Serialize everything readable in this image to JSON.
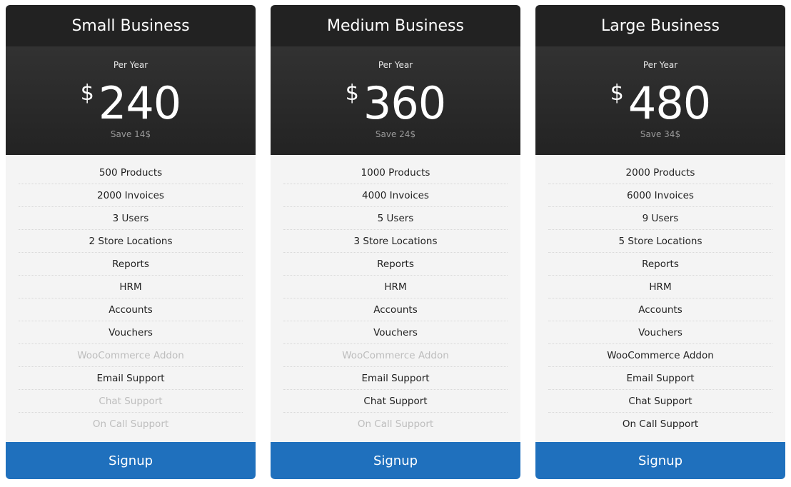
{
  "plans": [
    {
      "name": "Small Business",
      "period": "Per Year",
      "currency": "$",
      "price": "240",
      "savings": "Save 14$",
      "features": [
        {
          "label": "500 Products",
          "included": true
        },
        {
          "label": "2000 Invoices",
          "included": true
        },
        {
          "label": "3 Users",
          "included": true
        },
        {
          "label": "2 Store Locations",
          "included": true
        },
        {
          "label": "Reports",
          "included": true
        },
        {
          "label": "HRM",
          "included": true
        },
        {
          "label": "Accounts",
          "included": true
        },
        {
          "label": "Vouchers",
          "included": true
        },
        {
          "label": "WooCommerce Addon",
          "included": false
        },
        {
          "label": "Email Support",
          "included": true
        },
        {
          "label": "Chat Support",
          "included": false
        },
        {
          "label": "On Call Support",
          "included": false
        }
      ],
      "button_label": "Signup"
    },
    {
      "name": "Medium Business",
      "period": "Per Year",
      "currency": "$",
      "price": "360",
      "savings": "Save 24$",
      "features": [
        {
          "label": "1000 Products",
          "included": true
        },
        {
          "label": "4000 Invoices",
          "included": true
        },
        {
          "label": "5 Users",
          "included": true
        },
        {
          "label": "3 Store Locations",
          "included": true
        },
        {
          "label": "Reports",
          "included": true
        },
        {
          "label": "HRM",
          "included": true
        },
        {
          "label": "Accounts",
          "included": true
        },
        {
          "label": "Vouchers",
          "included": true
        },
        {
          "label": "WooCommerce Addon",
          "included": false
        },
        {
          "label": "Email Support",
          "included": true
        },
        {
          "label": "Chat Support",
          "included": true
        },
        {
          "label": "On Call Support",
          "included": false
        }
      ],
      "button_label": "Signup"
    },
    {
      "name": "Large Business",
      "period": "Per Year",
      "currency": "$",
      "price": "480",
      "savings": "Save 34$",
      "features": [
        {
          "label": "2000 Products",
          "included": true
        },
        {
          "label": "6000 Invoices",
          "included": true
        },
        {
          "label": "9 Users",
          "included": true
        },
        {
          "label": "5 Store Locations",
          "included": true
        },
        {
          "label": "Reports",
          "included": true
        },
        {
          "label": "HRM",
          "included": true
        },
        {
          "label": "Accounts",
          "included": true
        },
        {
          "label": "Vouchers",
          "included": true
        },
        {
          "label": "WooCommerce Addon",
          "included": true
        },
        {
          "label": "Email Support",
          "included": true
        },
        {
          "label": "Chat Support",
          "included": true
        },
        {
          "label": "On Call Support",
          "included": true
        }
      ],
      "button_label": "Signup"
    }
  ],
  "colors": {
    "header_bg": "#222222",
    "features_bg": "#f4f4f4",
    "accent": "#1f70bd",
    "disabled_text": "#bdbdbd"
  }
}
